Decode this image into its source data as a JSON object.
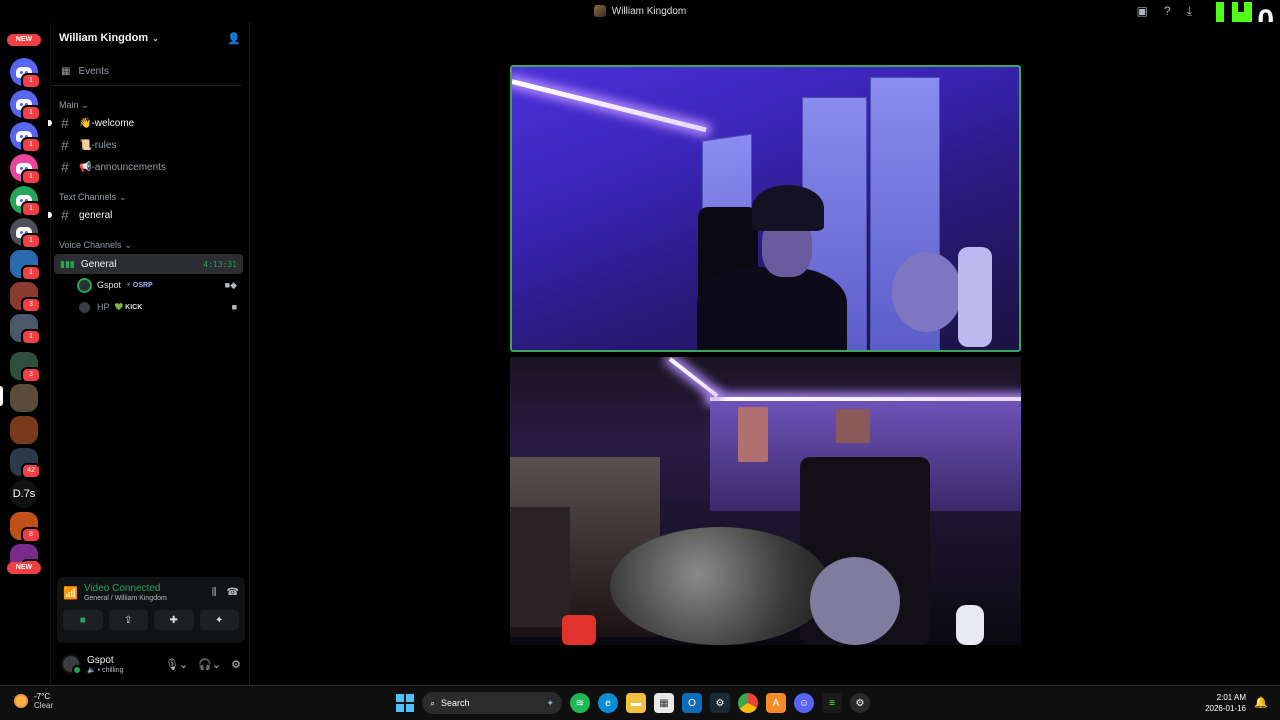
{
  "window": {
    "title": "William Kingdom"
  },
  "kick": {
    "count": "0"
  },
  "servers": [
    {
      "top": "NEW",
      "kind": "new"
    },
    {
      "badge": "1",
      "color": "#5865f2",
      "kind": "discord"
    },
    {
      "badge": "1",
      "color": "#5865f2",
      "kind": "discord"
    },
    {
      "badge": "1",
      "color": "#5865f2",
      "kind": "discord"
    },
    {
      "badge": "1",
      "color": "#eb459e",
      "kind": "discord"
    },
    {
      "badge": "1",
      "color": "#23a55a",
      "kind": "discord"
    },
    {
      "badge": "1",
      "color": "#4e5058",
      "kind": "discord"
    },
    {
      "badge": "1",
      "color": "#2b6cb0",
      "kind": "image"
    },
    {
      "badge": "3",
      "color": "#8b3a2e",
      "kind": "image"
    },
    {
      "badge": "1",
      "color": "#4a5a6a",
      "kind": "image"
    },
    {
      "badge": "3",
      "color": "#2f4f3f",
      "kind": "image"
    },
    {
      "badge": "",
      "color": "#5a4a3a",
      "kind": "image"
    },
    {
      "badge": "",
      "color": "#7a3a1a",
      "kind": "image"
    },
    {
      "badge": "42",
      "color": "#2a3a4a",
      "kind": "image"
    },
    {
      "label": "D.7s",
      "color": "#111",
      "kind": "text"
    },
    {
      "badge": "8",
      "color": "#c0501a",
      "kind": "image"
    },
    {
      "badge": "26",
      "color": "#7a2a8a",
      "kind": "image"
    },
    {
      "top": "NEW",
      "kind": "new"
    }
  ],
  "sidebar": {
    "server_name": "William Kingdom",
    "events_label": "Events",
    "categories": {
      "main": "Main",
      "text": "Text Channels",
      "voice": "Voice Channels"
    },
    "main_channels": [
      "👋-welcome",
      "📜-rules",
      "📢-announcements"
    ],
    "text_channels": [
      "general"
    ],
    "voice_channel": {
      "name": "General",
      "timer": "4:13:31"
    },
    "voice_users": [
      {
        "name": "Gspot",
        "tag": "⚡ OSRP"
      },
      {
        "name": "HP",
        "tag": "💚 KICK"
      }
    ]
  },
  "voice_panel": {
    "status": "Video Connected",
    "location": "General / William Kingdom"
  },
  "user_panel": {
    "name": "Gspot",
    "status": "chilling"
  },
  "taskbar": {
    "temp": "-7°C",
    "condition": "Clear",
    "search_placeholder": "Search",
    "time": "2:01 AM",
    "date": "2026-01-16"
  },
  "icons": {
    "hash": "#",
    "inbox": "inbox-icon",
    "help": "help-icon",
    "download": "download-icon"
  }
}
